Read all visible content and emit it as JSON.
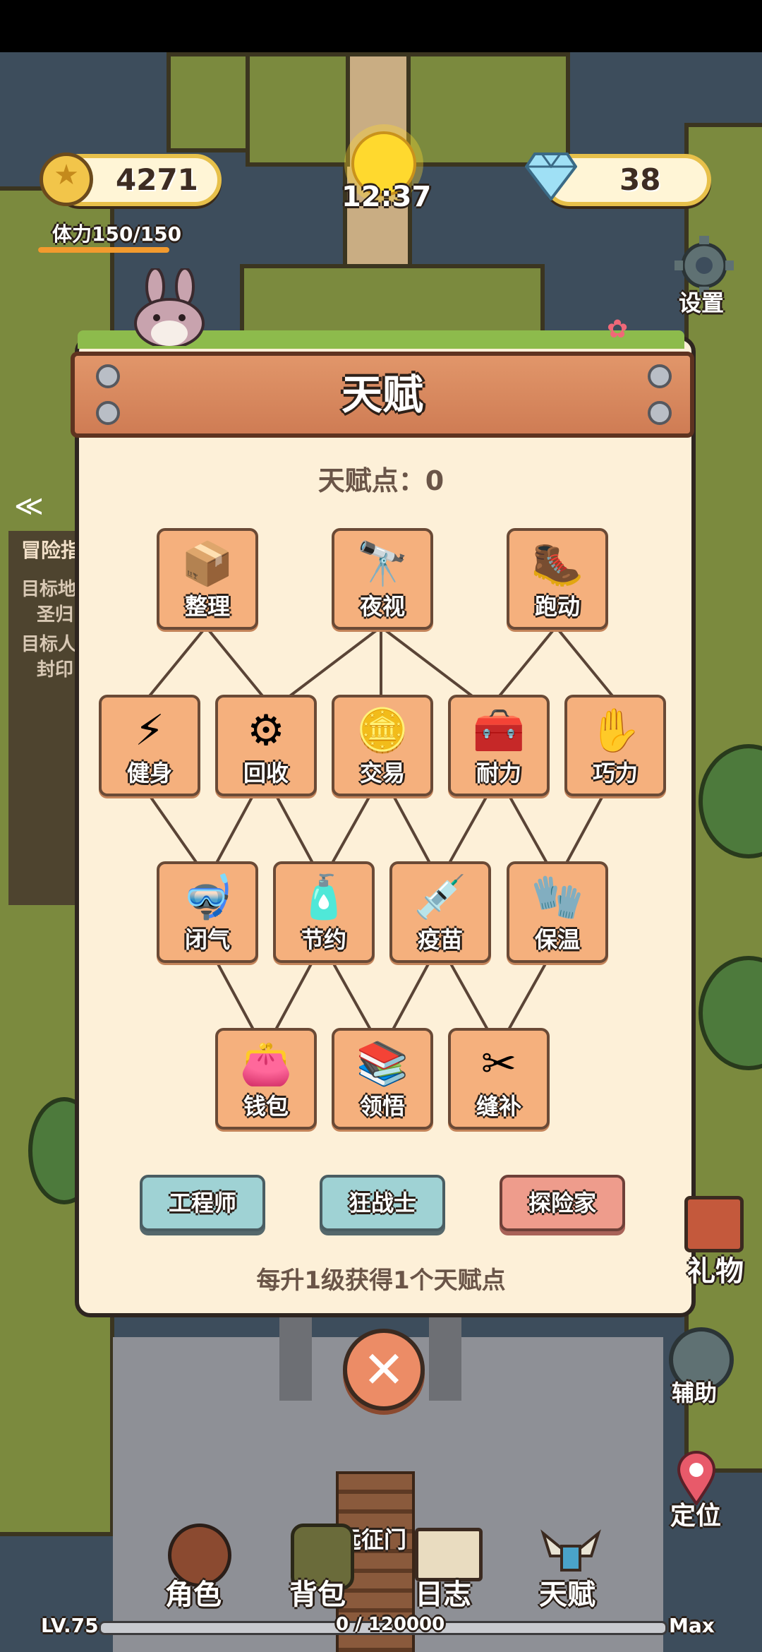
{
  "hud": {
    "coins": "4271",
    "time": "12:37",
    "gems": "38",
    "stamina_label": "体力150/150",
    "stamina_fraction": 1.0,
    "settings_label": "设置"
  },
  "side_panel": {
    "tab": "冒险指",
    "line1": "目标地",
    "line2": "圣归",
    "line3": "目标人",
    "line4": "封印"
  },
  "dialog": {
    "title": "天赋",
    "points_label": "天赋点：0",
    "hint": "每升1级获得1个天赋点",
    "close_icon": "close-icon",
    "talents": [
      {
        "label": "整理",
        "icon": "crate-icon",
        "glyph": "📦"
      },
      {
        "label": "夜视",
        "icon": "binoculars-icon",
        "glyph": "🔭"
      },
      {
        "label": "跑动",
        "icon": "boots-icon",
        "glyph": "🥾"
      },
      {
        "label": "健身",
        "icon": "lightning-icon",
        "glyph": "⚡"
      },
      {
        "label": "回收",
        "icon": "gear-icon",
        "glyph": "⚙"
      },
      {
        "label": "交易",
        "icon": "coins-icon",
        "glyph": "🪙"
      },
      {
        "label": "耐力",
        "icon": "first-aid-icon",
        "glyph": "🧰"
      },
      {
        "label": "巧力",
        "icon": "hand-icon",
        "glyph": "✋"
      },
      {
        "label": "闭气",
        "icon": "oxygen-tank-icon",
        "glyph": "🤿"
      },
      {
        "label": "节约",
        "icon": "bottle-icon",
        "glyph": "🧴"
      },
      {
        "label": "疫苗",
        "icon": "syringe-icon",
        "glyph": "💉"
      },
      {
        "label": "保温",
        "icon": "gloves-icon",
        "glyph": "🧤"
      },
      {
        "label": "钱包",
        "icon": "wallet-icon",
        "glyph": "👛"
      },
      {
        "label": "领悟",
        "icon": "books-icon",
        "glyph": "📚"
      },
      {
        "label": "缝补",
        "icon": "scissors-icon",
        "glyph": "✂"
      }
    ],
    "classes": [
      {
        "label": "工程师",
        "color": "#9fd2d4"
      },
      {
        "label": "狂战士",
        "color": "#9fd2d4"
      },
      {
        "label": "探险家",
        "color": "#ee9c8c"
      }
    ]
  },
  "right_menu": {
    "gift_label": "礼物",
    "assist_label": "辅助",
    "locate_label": "定位"
  },
  "bottom_bar": {
    "gate_label": "远征门",
    "tabs": [
      "角色",
      "背包",
      "日志",
      "天赋"
    ],
    "level": "LV.75",
    "xp": "0 / 120000",
    "xp_fraction": 0,
    "max_label": "Max"
  }
}
